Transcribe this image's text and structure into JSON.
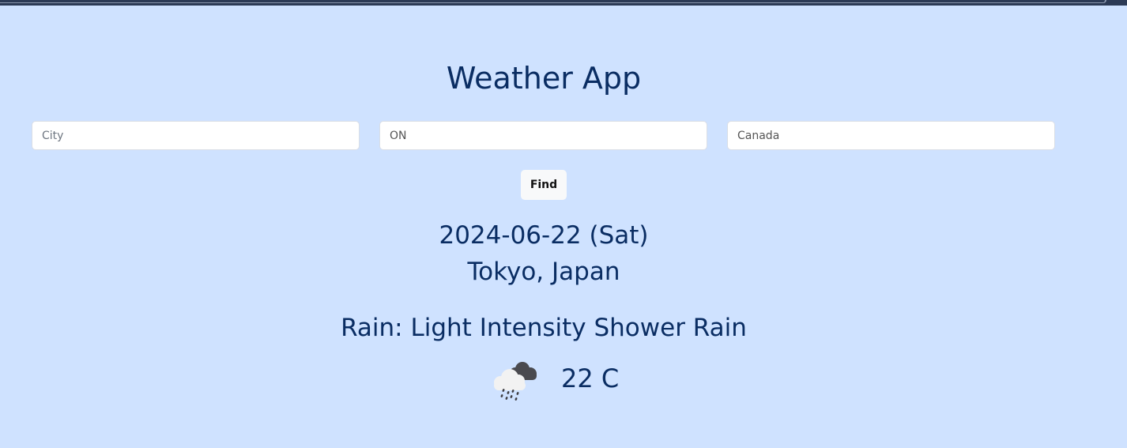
{
  "app": {
    "title": "Weather App"
  },
  "search": {
    "city_placeholder": "City",
    "state_value": "ON",
    "country_value": "Canada",
    "find_label": "Find"
  },
  "result": {
    "date": "2024-06-22 (Sat)",
    "location": "Tokyo, Japan",
    "condition": "Rain: Light Intensity Shower Rain",
    "temperature": "22 C",
    "icon": "shower-rain-icon"
  },
  "colors": {
    "background": "#cfe2ff",
    "text": "#0a2d63",
    "top_bar": "#2c3a55",
    "button_bg": "#f8f9fa"
  }
}
